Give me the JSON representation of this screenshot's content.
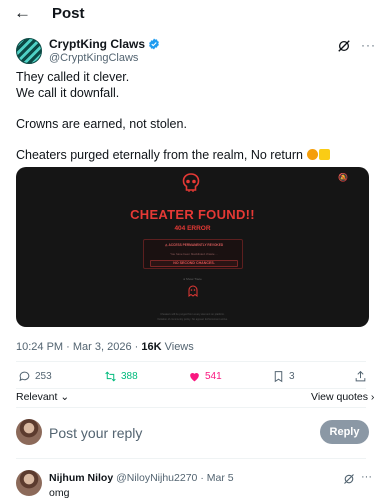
{
  "header": {
    "back_icon": "arrow-left-icon",
    "title": "Post"
  },
  "author": {
    "name": "CryptKing Claws",
    "handle": "@CryptKingClaws",
    "verified_color": "#1d9bf0"
  },
  "tweet": {
    "line1": "They called it clever.",
    "line2": "We call it downfall.",
    "line3": "Crowns are earned, not stolen.",
    "line4": "Cheaters purged eternally from the realm, No return",
    "emoji": [
      "lion-face-emoji",
      "locked-emoji"
    ]
  },
  "media": {
    "title": "CHEATER FOUND!!",
    "error": "404 ERROR",
    "alert_title": "ACCESS PERMANENTLY REVOKED",
    "alert_sub": "You have been blacklisted chaste ...",
    "alert_button": "NO SECOND CHANCES",
    "show_trace": "Show Trace",
    "footer1": "Cheaters will be purged from every element on platform.",
    "footer2": "Violation of community policy. No appeal. Enforcement active.",
    "accent": "#e53935"
  },
  "meta": {
    "time": "10:24 PM",
    "date": "Mar 3, 2026",
    "views_count": "16K",
    "views_label": "Views"
  },
  "actions": {
    "replies": "253",
    "reposts": "388",
    "likes": "541",
    "bookmarks": "3",
    "repost_color": "#00ba7c",
    "like_color": "#f91880"
  },
  "sort": {
    "relevant": "Relevant",
    "view_quotes": "View quotes"
  },
  "reply_box": {
    "placeholder": "Post your reply",
    "button": "Reply"
  },
  "comment": {
    "name": "Nijhum Niloy",
    "handle": "@NiloyNijhu2270",
    "separator": "·",
    "date": "Mar 5",
    "text": "omg"
  }
}
